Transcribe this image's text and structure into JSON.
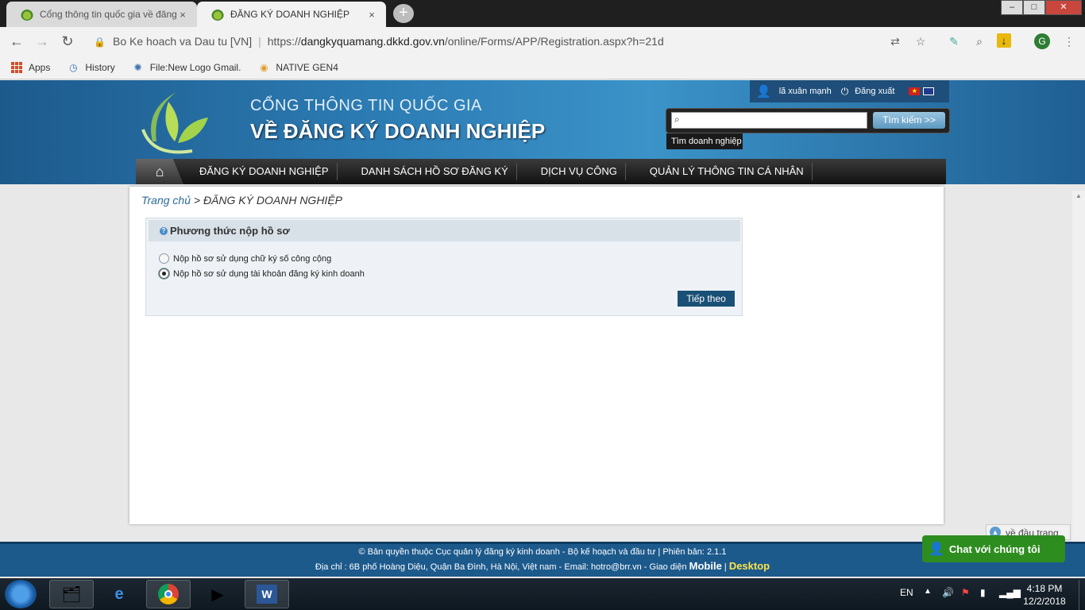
{
  "browser": {
    "tabs": [
      {
        "title": "Cổng thông tin quốc gia về đăng",
        "close": "×"
      },
      {
        "title": "ĐĂNG KÝ DOANH NGHIỆP",
        "close": "×"
      }
    ],
    "new_tab": "+",
    "window_controls": [
      "–",
      "□",
      "✕"
    ],
    "address": {
      "security_label": "Bo Ke hoach va Dau tu [VN]",
      "url_prefix": "https://",
      "url_host": "dangkyquamang.dkkd.gov.vn",
      "url_path": "/online/Forms/APP/Registration.aspx?h=21d"
    },
    "profile_initial": "G",
    "bookmarks": [
      {
        "label": "Apps"
      },
      {
        "label": "History"
      },
      {
        "label": "File:New Logo Gmail."
      },
      {
        "label": "NATIVE GEN4"
      }
    ]
  },
  "site": {
    "title_line1": "CỔNG THÔNG TIN QUỐC GIA",
    "title_line2": "VỀ ĐĂNG KÝ DOANH NGHIỆP",
    "user_name": "lã xuân mạnh",
    "logout": "Đăng xuất",
    "search_button": "Tìm kiếm >>",
    "search_placeholder": "",
    "search_tooltip": "Tìm doanh nghiệp",
    "nav": [
      "ĐĂNG KÝ DOANH NGHIỆP",
      "DANH SÁCH HỒ SƠ ĐĂNG KÝ",
      "DỊCH VỤ CÔNG",
      "QUẢN LÝ THÔNG TIN CÁ NHÂN"
    ]
  },
  "page": {
    "breadcrumb_home": "Trang chủ",
    "breadcrumb_sep": " > ",
    "breadcrumb_current": "ĐĂNG KÝ DOANH NGHIỆP",
    "panel_title": "Phương thức nộp hồ sơ",
    "options": [
      {
        "label": "Nộp hồ sơ sử dụng chữ ký số công cộng",
        "selected": false
      },
      {
        "label": "Nộp hồ sơ sử dụng tài khoản đăng ký kinh doanh",
        "selected": true
      }
    ],
    "next_button": "Tiếp theo",
    "back_to_top": "về đầu trang",
    "chat": "Chat với chúng tôi"
  },
  "footer": {
    "line1": "© Bản quyền thuộc Cục quản lý đăng ký kinh doanh - Bộ kế hoạch và đầu tư | Phiên bản: 2.1.1",
    "line2_prefix": "Địa chỉ : 6B phố Hoàng Diệu, Quận Ba Đình, Hà Nội, Việt nam - Email: ",
    "email": "hotro@brr.vn",
    "line2_mid": " - Giao diện ",
    "mobile": "Mobile",
    "pipe": " | ",
    "desktop": "Desktop"
  },
  "taskbar": {
    "language": "EN",
    "time": "4:18 PM",
    "date": "12/2/2018"
  },
  "colors": {
    "header_blue": "#2c7cb4",
    "nav_black": "#111111",
    "next_button": "#1a5075",
    "chat_green": "#2e8d1f",
    "desktop_yellow": "#ffe24a"
  }
}
